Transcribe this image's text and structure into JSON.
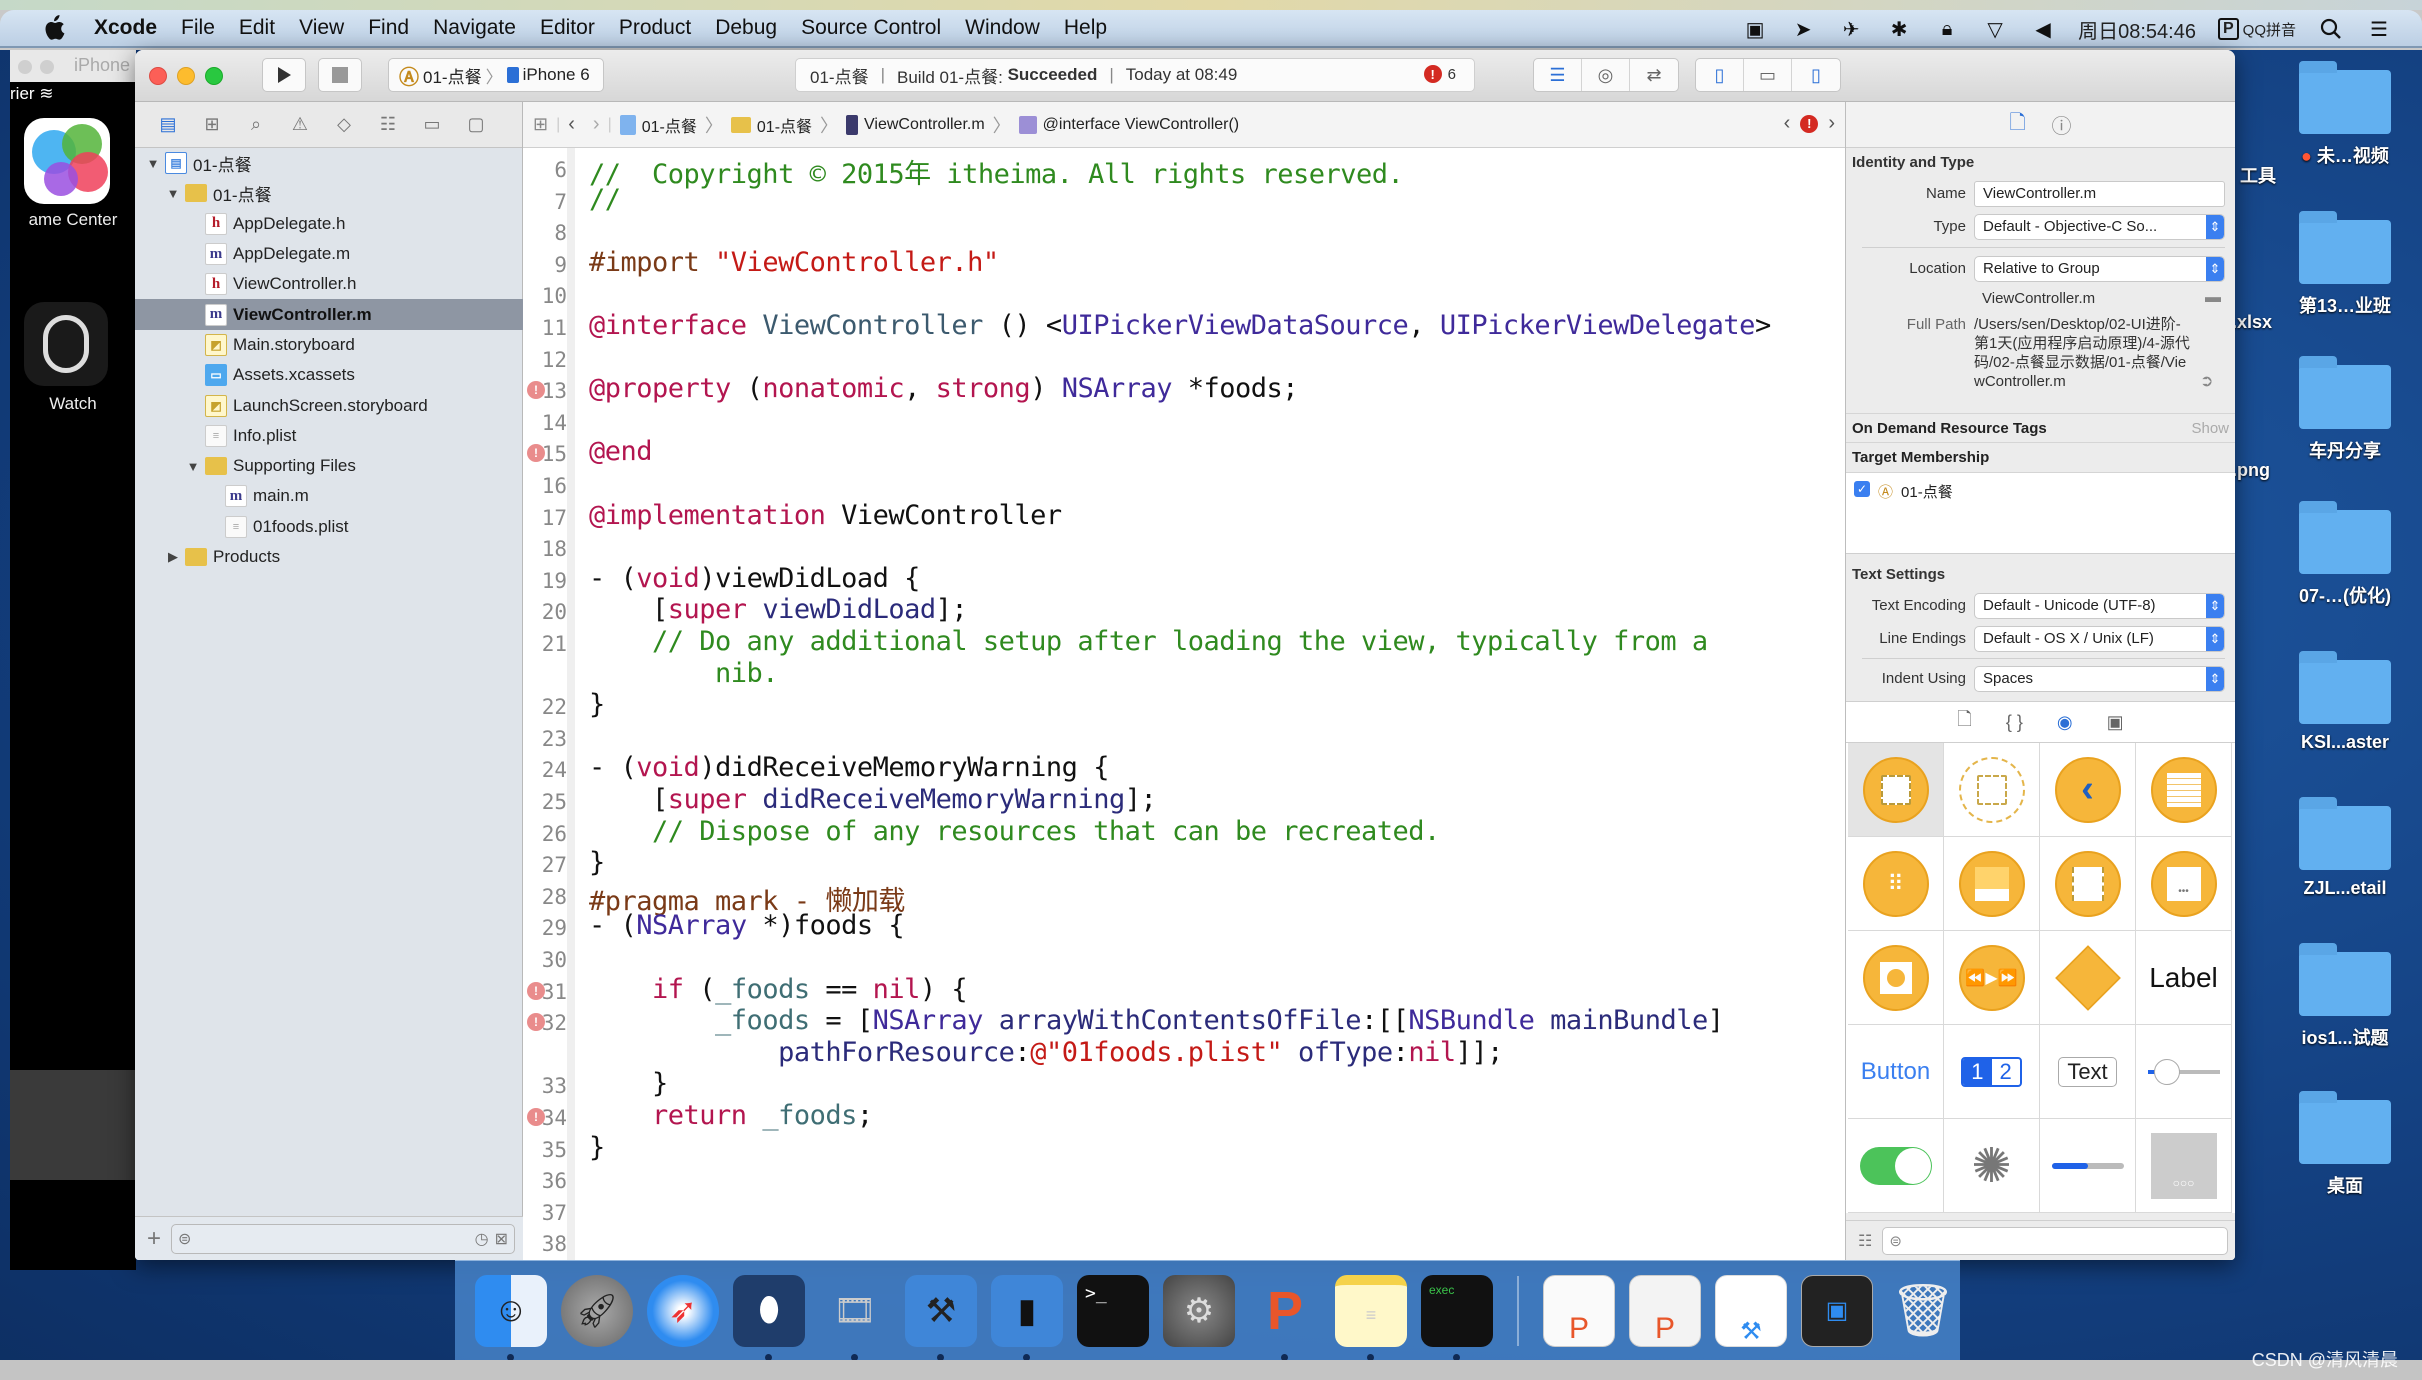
{
  "menubar": {
    "apple": "",
    "items": [
      "Xcode",
      "File",
      "Edit",
      "View",
      "Find",
      "Navigate",
      "Editor",
      "Product",
      "Debug",
      "Source Control",
      "Window",
      "Help"
    ],
    "status_icons": [
      "screen-record-icon",
      "location-icon",
      "airplane-icon",
      "bluetooth-icon",
      "lock-icon",
      "wifi-icon",
      "volume-icon"
    ],
    "clock": "周日08:54:46",
    "input_method": "QQ拼音",
    "input_badge": "P"
  },
  "simulator": {
    "title": "iPhone",
    "carrier": "rier",
    "apps": [
      {
        "label": "ame Center",
        "icon": "game-center-icon"
      },
      {
        "label": "Watch",
        "icon": "watch-icon"
      }
    ]
  },
  "toolbar": {
    "scheme": "01-点餐",
    "device": "iPhone 6",
    "activity": {
      "project": "01-点餐",
      "build_prefix": "Build 01-点餐:",
      "build_status": "Succeeded",
      "time": "Today at 08:49",
      "error_count": "6"
    }
  },
  "navigator": {
    "tree": [
      {
        "label": "01-点餐",
        "type": "project",
        "depth": 0,
        "expanded": true
      },
      {
        "label": "01-点餐",
        "type": "folder",
        "depth": 1,
        "expanded": true
      },
      {
        "label": "AppDelegate.h",
        "type": "h",
        "depth": 2
      },
      {
        "label": "AppDelegate.m",
        "type": "m",
        "depth": 2
      },
      {
        "label": "ViewController.h",
        "type": "h",
        "depth": 2
      },
      {
        "label": "ViewController.m",
        "type": "m",
        "depth": 2,
        "selected": true
      },
      {
        "label": "Main.storyboard",
        "type": "storyboard",
        "depth": 2
      },
      {
        "label": "Assets.xcassets",
        "type": "assets",
        "depth": 2
      },
      {
        "label": "LaunchScreen.storyboard",
        "type": "storyboard",
        "depth": 2
      },
      {
        "label": "Info.plist",
        "type": "plist",
        "depth": 2
      },
      {
        "label": "Supporting Files",
        "type": "folder",
        "depth": 2,
        "expanded": true
      },
      {
        "label": "main.m",
        "type": "m",
        "depth": 3
      },
      {
        "label": "01foods.plist",
        "type": "plist",
        "depth": 3
      },
      {
        "label": "Products",
        "type": "folder",
        "depth": 1,
        "expanded": false
      }
    ],
    "filter_placeholder": ""
  },
  "jumpbar": {
    "crumbs": [
      "01-点餐",
      "01-点餐",
      "ViewController.m",
      "@interface ViewController()"
    ]
  },
  "code": {
    "lines": [
      {
        "n": "6",
        "tokens": [
          [
            "cm",
            "//  Copyright © 2015年 itheima. All rights reserved."
          ]
        ]
      },
      {
        "n": "7",
        "tokens": [
          [
            "cm",
            "//"
          ]
        ]
      },
      {
        "n": "8",
        "tokens": []
      },
      {
        "n": "9",
        "tokens": [
          [
            "pp",
            "#import "
          ],
          [
            "str",
            "\"ViewController.h\""
          ]
        ]
      },
      {
        "n": "10",
        "tokens": []
      },
      {
        "n": "11",
        "tokens": [
          [
            "kw",
            "@interface"
          ],
          [
            "",
            " "
          ],
          [
            "cls",
            "ViewController"
          ],
          [
            "",
            " () <"
          ],
          [
            "ty",
            "UIPickerViewDataSource"
          ],
          [
            "",
            ", "
          ],
          [
            "ty",
            "UIPickerViewDelegate"
          ],
          [
            "",
            ">"
          ]
        ]
      },
      {
        "n": "12",
        "tokens": []
      },
      {
        "n": "13",
        "err": true,
        "tokens": [
          [
            "kw",
            "@property"
          ],
          [
            "",
            " ("
          ],
          [
            "kw",
            "nonatomic"
          ],
          [
            "",
            ", "
          ],
          [
            "kw",
            "strong"
          ],
          [
            "",
            ") "
          ],
          [
            "ty",
            "NSArray"
          ],
          [
            "",
            " *foods;"
          ]
        ]
      },
      {
        "n": "14",
        "tokens": []
      },
      {
        "n": "15",
        "err": true,
        "tokens": [
          [
            "kw",
            "@end"
          ]
        ]
      },
      {
        "n": "16",
        "tokens": []
      },
      {
        "n": "17",
        "tokens": [
          [
            "kw",
            "@implementation"
          ],
          [
            "",
            " ViewController"
          ]
        ]
      },
      {
        "n": "18",
        "tokens": []
      },
      {
        "n": "19",
        "tokens": [
          [
            "",
            "- ("
          ],
          [
            "kw",
            "void"
          ],
          [
            "",
            ")viewDidLoad {"
          ]
        ]
      },
      {
        "n": "20",
        "tokens": [
          [
            "",
            "    ["
          ],
          [
            "kw",
            "super"
          ],
          [
            "",
            " "
          ],
          [
            "me",
            "viewDidLoad"
          ],
          [
            "",
            "];"
          ]
        ]
      },
      {
        "n": "21",
        "tokens": [
          [
            "cm",
            "    // Do any additional setup after loading the view, typically from a"
          ]
        ]
      },
      {
        "n": "",
        "tokens": [
          [
            "cm",
            "        nib."
          ]
        ]
      },
      {
        "n": "22",
        "tokens": [
          [
            "",
            "}"
          ]
        ]
      },
      {
        "n": "23",
        "tokens": []
      },
      {
        "n": "24",
        "tokens": [
          [
            "",
            "- ("
          ],
          [
            "kw",
            "void"
          ],
          [
            "",
            ")didReceiveMemoryWarning {"
          ]
        ]
      },
      {
        "n": "25",
        "tokens": [
          [
            "",
            "    ["
          ],
          [
            "kw",
            "super"
          ],
          [
            "",
            " "
          ],
          [
            "me",
            "didReceiveMemoryWarning"
          ],
          [
            "",
            "];"
          ]
        ]
      },
      {
        "n": "26",
        "tokens": [
          [
            "cm",
            "    // Dispose of any resources that can be recreated."
          ]
        ]
      },
      {
        "n": "27",
        "tokens": [
          [
            "",
            "}"
          ]
        ]
      },
      {
        "n": "28",
        "tokens": [
          [
            "pp",
            "#pragma mark - 懒加载"
          ]
        ]
      },
      {
        "n": "29",
        "tokens": [
          [
            "",
            "- ("
          ],
          [
            "ty",
            "NSArray"
          ],
          [
            "",
            " *)foods {"
          ]
        ]
      },
      {
        "n": "30",
        "tokens": []
      },
      {
        "n": "31",
        "err": true,
        "tokens": [
          [
            "",
            "    "
          ],
          [
            "kw",
            "if"
          ],
          [
            "",
            " ("
          ],
          [
            "iv",
            "_foods"
          ],
          [
            "",
            " == "
          ],
          [
            "kw",
            "nil"
          ],
          [
            "",
            ") {"
          ]
        ]
      },
      {
        "n": "32",
        "err": true,
        "tokens": [
          [
            "",
            "        "
          ],
          [
            "iv",
            "_foods"
          ],
          [
            "",
            " = ["
          ],
          [
            "ty",
            "NSArray"
          ],
          [
            "",
            " "
          ],
          [
            "me",
            "arrayWithContentsOfFile"
          ],
          [
            "",
            ":[["
          ],
          [
            "ty",
            "NSBundle"
          ],
          [
            "",
            " "
          ],
          [
            "me",
            "mainBundle"
          ],
          [
            "",
            "]"
          ]
        ]
      },
      {
        "n": "",
        "tokens": [
          [
            "",
            "            "
          ],
          [
            "me",
            "pathForResource"
          ],
          [
            "",
            ":"
          ],
          [
            "str",
            "@\"01foods.plist\""
          ],
          [
            "",
            " "
          ],
          [
            "me",
            "ofType"
          ],
          [
            "",
            ":"
          ],
          [
            "kw",
            "nil"
          ],
          [
            "",
            "]];"
          ]
        ]
      },
      {
        "n": "33",
        "tokens": [
          [
            "",
            "    }"
          ]
        ]
      },
      {
        "n": "34",
        "err": true,
        "tokens": [
          [
            "",
            "    "
          ],
          [
            "kw",
            "return"
          ],
          [
            "",
            " "
          ],
          [
            "iv",
            "_foods"
          ],
          [
            "",
            ";"
          ]
        ]
      },
      {
        "n": "35",
        "tokens": [
          [
            "",
            "}"
          ]
        ]
      },
      {
        "n": "36",
        "tokens": []
      },
      {
        "n": "37",
        "tokens": []
      },
      {
        "n": "38",
        "tokens": []
      }
    ]
  },
  "inspector": {
    "identity": {
      "title": "Identity and Type",
      "name_label": "Name",
      "name_value": "ViewController.m",
      "type_label": "Type",
      "type_value": "Default - Objective-C So...",
      "location_label": "Location",
      "location_value": "Relative to Group",
      "location_file": "ViewController.m",
      "fullpath_label": "Full Path",
      "fullpath_value": "/Users/sen/Desktop/02-UI进阶-第1天(应用程序启动原理)/4-源代码/02-点餐显示数据/01-点餐/ViewController.m"
    },
    "on_demand": {
      "title": "On Demand Resource Tags",
      "action": "Show"
    },
    "target_membership": {
      "title": "Target Membership",
      "target": "01-点餐",
      "checked": true
    },
    "text_settings": {
      "title": "Text Settings",
      "encoding_label": "Text Encoding",
      "encoding_value": "Default - Unicode (UTF-8)",
      "line_endings_label": "Line Endings",
      "line_endings_value": "Default - OS X / Unix (LF)",
      "indent_label": "Indent Using",
      "indent_value": "Spaces"
    },
    "library": {
      "items": [
        "View Controller",
        "Storyboard Reference",
        "Navigation Controller",
        "Table View Controller",
        "Collection View Controller",
        "Tab Bar Controller",
        "Split View Controller",
        "Page View Controller",
        "GLKit View Controller",
        "AVKit Player View Controller",
        "Object",
        "Label",
        "Button",
        "Segmented Control",
        "Text Field",
        "Slider",
        "Switch",
        "Activity Indicator View",
        "Progress View",
        "Page Control"
      ],
      "label_text": "Label",
      "button_text": "Button",
      "segment_1": "1",
      "segment_2": "2",
      "textfield_text": "Text",
      "slider_value": 0.15,
      "switch_on": true,
      "progress_value": 0.5
    }
  },
  "desktop": {
    "icons": [
      "未…视频",
      "第13…业班",
      "车丹分享",
      "07-…(优化)",
      "KSI...aster",
      "ZJL...etail",
      "ios1...试题",
      "桌面"
    ],
    "partial_labels": [
      "工具",
      ".xlsx",
      ".png"
    ]
  },
  "dock": {
    "apps": [
      "Finder",
      "Launchpad",
      "Safari",
      "Mouse",
      "Photo Slideshow",
      "Xcode",
      "Simulator",
      "Terminal",
      "System Preferences",
      "PowerPoint",
      "Notes",
      "Console"
    ],
    "docs": [
      "PowerPoint Document 1",
      "PowerPoint Document 2",
      "Xcode Document",
      "Preview Window"
    ],
    "trash": "Trash"
  },
  "watermark": "CSDN @清风清晨",
  "colors": {
    "accent": "#2b6fd6",
    "error": "#d42a22",
    "comment": "#2f8a1f",
    "keyword": "#b3154f",
    "string": "#c41a16"
  }
}
